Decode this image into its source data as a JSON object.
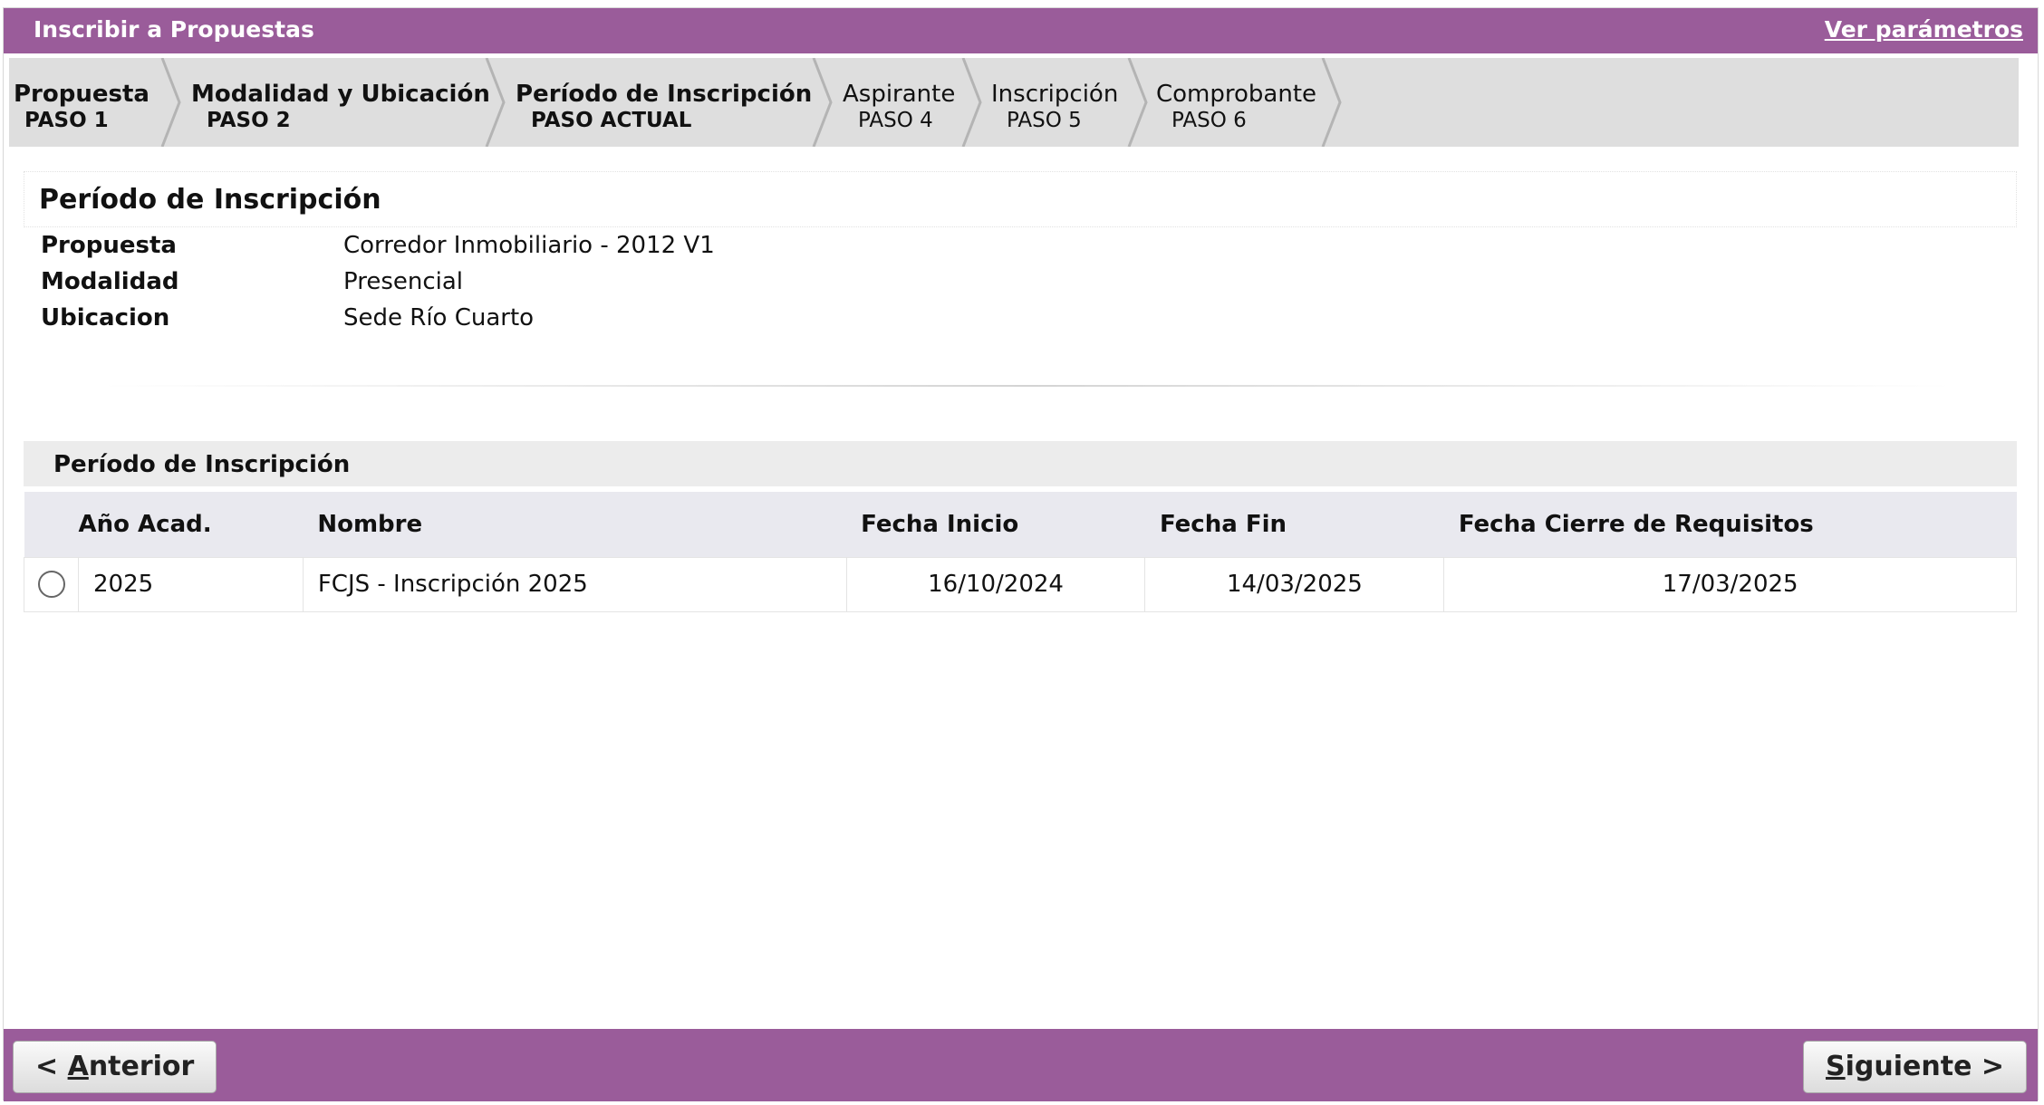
{
  "header": {
    "title": "Inscribir a Propuestas",
    "params_link": "Ver parámetros"
  },
  "steps": [
    {
      "name": "Propuesta",
      "num": "PASO 1",
      "state": "done"
    },
    {
      "name": "Modalidad y Ubicación",
      "num": "PASO 2",
      "state": "done"
    },
    {
      "name": "Período de Inscripción",
      "num": "PASO ACTUAL",
      "state": "current"
    },
    {
      "name": "Aspirante",
      "num": "PASO 4",
      "state": "pending"
    },
    {
      "name": "Inscripción",
      "num": "PASO 5",
      "state": "pending"
    },
    {
      "name": "Comprobante",
      "num": "PASO 6",
      "state": "pending"
    }
  ],
  "section": {
    "title": "Período de Inscripción",
    "fields": [
      {
        "label": "Propuesta",
        "value": "Corredor Inmobiliario - 2012 V1"
      },
      {
        "label": "Modalidad",
        "value": "Presencial"
      },
      {
        "label": "Ubicacion",
        "value": "Sede Río Cuarto"
      }
    ]
  },
  "grid": {
    "title": "Período de Inscripción",
    "columns": [
      "Año Acad.",
      "Nombre",
      "Fecha Inicio",
      "Fecha Fin",
      "Fecha Cierre de Requisitos"
    ],
    "rows": [
      {
        "anio": "2025",
        "nombre": "FCJS - Inscripción 2025",
        "inicio": "16/10/2024",
        "fin": "14/03/2025",
        "cierre": "17/03/2025",
        "selected": false
      }
    ]
  },
  "footer": {
    "prev_prefix": "< ",
    "prev_key": "A",
    "prev_rest": "nterior",
    "next_key": "S",
    "next_rest": "iguiente >"
  },
  "colors": {
    "accent": "#9a5c9a",
    "steps_bg": "#dedede"
  }
}
